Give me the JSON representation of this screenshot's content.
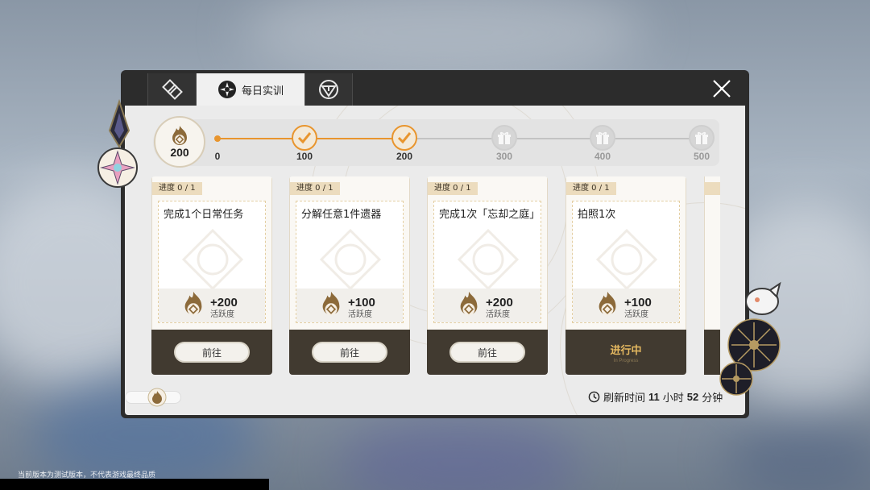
{
  "tabs": [
    {
      "label": "",
      "icon": "diamond-cards-icon"
    },
    {
      "label": "每日实训",
      "icon": "compass-cross-icon"
    },
    {
      "label": "",
      "icon": "hexagon-tri-icon"
    }
  ],
  "activity": {
    "current": "200",
    "milestones": [
      "0",
      "100",
      "200",
      "300",
      "400",
      "500"
    ],
    "completed_count": 2
  },
  "cards": [
    {
      "progress": "进度 0 / 1",
      "title": "完成1个日常任务",
      "reward_value": "+200",
      "reward_unit": "活跃度",
      "action": "前往"
    },
    {
      "progress": "进度 0 / 1",
      "title": "分解任意1件遗器",
      "reward_value": "+100",
      "reward_unit": "活跃度",
      "action": "前往"
    },
    {
      "progress": "进度 0 / 1",
      "title": "完成1次「忘却之庭」",
      "reward_value": "+200",
      "reward_unit": "活跃度",
      "action": "前往"
    },
    {
      "progress": "进度 0 / 1",
      "title": "拍照1次",
      "reward_value": "+100",
      "reward_unit": "活跃度",
      "action": "进行中",
      "action_sub": "In Progress"
    }
  ],
  "refresh": {
    "prefix": "刷新时间",
    "h": "11",
    "h_unit": "小时",
    "m": "52",
    "m_unit": "分钟"
  },
  "footer_notice": "当前版本为测试版本，不代表游戏最终品质",
  "colors": {
    "accent": "#e8952e",
    "card_dark": "#413a30",
    "gold": "#e4b860"
  }
}
